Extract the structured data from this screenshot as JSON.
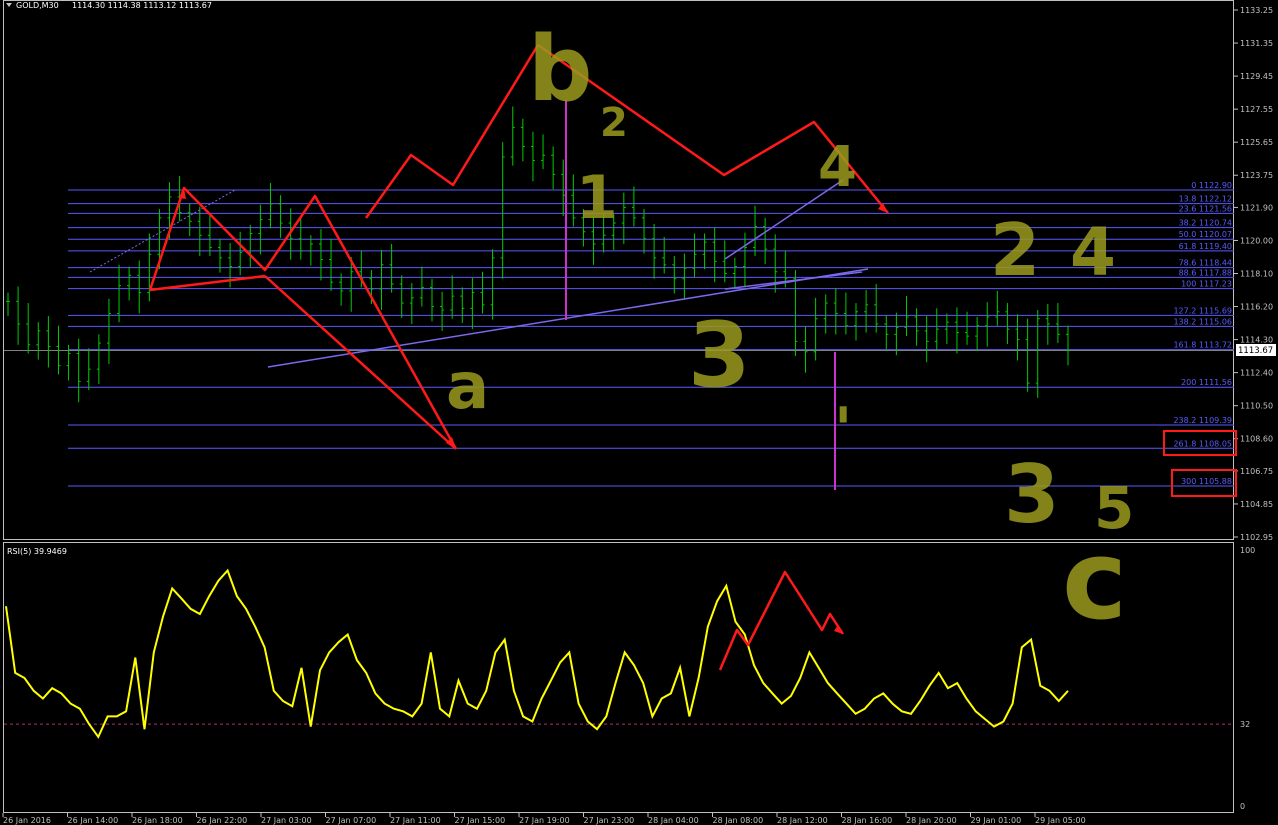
{
  "header": {
    "symbol": "GOLD,M30",
    "ohlc": "1114.30 1114.38 1113.12 1113.67"
  },
  "price_axis": {
    "ticks": [
      "1133.25",
      "1131.35",
      "1129.45",
      "1127.55",
      "1125.65",
      "1123.75",
      "1121.90",
      "1120.00",
      "1118.10",
      "1116.20",
      "1114.30",
      "1112.40",
      "1110.50",
      "1108.60",
      "1106.75",
      "1104.85",
      "1102.95"
    ],
    "current_price": "1113.67"
  },
  "rsi": {
    "label": "RSI(5) 39.9469",
    "axis_ticks": [
      "100",
      "32",
      "0"
    ],
    "level": 32
  },
  "time_axis": {
    "ticks": [
      "26 Jan 2016",
      "26 Jan 14:00",
      "26 Jan 18:00",
      "26 Jan 22:00",
      "27 Jan 03:00",
      "27 Jan 07:00",
      "27 Jan 11:00",
      "27 Jan 15:00",
      "27 Jan 19:00",
      "27 Jan 23:00",
      "28 Jan 04:00",
      "28 Jan 08:00",
      "28 Jan 12:00",
      "28 Jan 16:00",
      "28 Jan 20:00",
      "29 Jan 01:00",
      "29 Jan 05:00"
    ]
  },
  "fib_levels": [
    {
      "label": "0 1122.90",
      "price": 1122.9
    },
    {
      "label": "13.8 1122.12",
      "price": 1122.12
    },
    {
      "label": "23.6 1121.56",
      "price": 1121.56
    },
    {
      "label": "38.2 1120.74",
      "price": 1120.74
    },
    {
      "label": "50.0 1120.07",
      "price": 1120.07
    },
    {
      "label": "61.8 1119.40",
      "price": 1119.4
    },
    {
      "label": "78.6 1118.44",
      "price": 1118.44
    },
    {
      "label": "88.6 1117.88",
      "price": 1117.88
    },
    {
      "label": "100 1117.23",
      "price": 1117.23
    },
    {
      "label": "127.2 1115.69",
      "price": 1115.69
    },
    {
      "label": "138.2 1115.06",
      "price": 1115.06
    },
    {
      "label": "161.8 1113.72",
      "price": 1113.72
    },
    {
      "label": "200 1111.56",
      "price": 1111.56
    },
    {
      "label": "238.2 1109.39",
      "price": 1109.39
    },
    {
      "label": "261.8 1108.05",
      "price": 1108.05
    },
    {
      "label": "300 1105.88",
      "price": 1105.88
    }
  ],
  "highlighted_levels": [
    "261.8 1108.05",
    "300 1105.88"
  ],
  "annotations": [
    "b",
    "2",
    "1",
    "4",
    "3",
    "a",
    "2",
    "4",
    "'",
    "3",
    "5",
    "c"
  ],
  "colors": {
    "background": "#000000",
    "bars": "#00cc00",
    "fib": "#5a5aff",
    "trendline": "#7b68ee",
    "arrows": "#ff1a1a",
    "handwriting": "#9a9a1e",
    "rsi": "#ffff00",
    "spike": "#cc33cc",
    "axis_text": "#c0c0c0"
  },
  "chart_data": [
    {
      "type": "ohlc",
      "title": "GOLD,M30",
      "ylim": [
        1102.95,
        1133.25
      ],
      "series": [
        {
          "name": "GOLD,M30",
          "close_approx": [
            1116.5,
            1115.2,
            1114.0,
            1114.8,
            1113.9,
            1112.8,
            1113.5,
            1111.9,
            1112.6,
            1114.1,
            1115.8,
            1117.4,
            1118.0,
            1117.0,
            1119.2,
            1121.3,
            1122.5,
            1121.6,
            1121.1,
            1120.3,
            1119.6,
            1119.0,
            1118.5,
            1119.3,
            1120.4,
            1121.2,
            1122.1,
            1121.0,
            1120.1,
            1119.4,
            1119.8,
            1118.9,
            1117.6,
            1117.1,
            1118.2,
            1117.8,
            1117.2,
            1118.6,
            1117.5,
            1116.4,
            1116.7,
            1117.3,
            1116.2,
            1116.0,
            1116.8,
            1116.1,
            1117.0,
            1116.3,
            1119.0,
            1124.8,
            1126.5,
            1125.4,
            1124.6,
            1124.9,
            1123.8,
            1122.6,
            1121.3,
            1120.5,
            1119.8,
            1120.3,
            1121.0,
            1121.9,
            1121.3,
            1120.1,
            1119.0,
            1118.6,
            1117.8,
            1118.4,
            1119.2,
            1119.9,
            1118.8,
            1118.1,
            1118.5,
            1119.6,
            1120.8,
            1119.5,
            1118.2,
            1117.8,
            1114.2,
            1113.6,
            1115.5,
            1116.4,
            1115.8,
            1115.1,
            1115.9,
            1116.3,
            1115.2,
            1114.6,
            1115.0,
            1115.6,
            1114.8,
            1114.2,
            1114.9,
            1115.3,
            1114.7,
            1114.5,
            1115.1,
            1115.6,
            1115.9,
            1114.9,
            1114.3,
            1111.8,
            1115.5,
            1115.2,
            1114.6,
            1113.67
          ]
        }
      ]
    },
    {
      "type": "line",
      "title": "RSI(5) 39.9469",
      "ylim": [
        0,
        100
      ],
      "series": [
        {
          "name": "RSI(5)",
          "values": [
            78,
            52,
            50,
            45,
            42,
            46,
            44,
            40,
            38,
            32,
            27,
            35,
            35,
            37,
            58,
            30,
            60,
            74,
            85,
            81,
            77,
            75,
            82,
            88,
            92,
            82,
            77,
            70,
            62,
            45,
            41,
            39,
            54,
            31,
            53,
            60,
            64,
            67,
            57,
            52,
            44,
            40,
            38,
            37,
            35,
            40,
            60,
            38,
            35,
            49,
            40,
            38,
            45,
            60,
            65,
            45,
            35,
            33,
            42,
            49,
            56,
            60,
            40,
            33,
            30,
            35,
            48,
            60,
            55,
            48,
            35,
            42,
            44,
            54,
            35,
            50,
            70,
            80,
            86,
            72,
            67,
            55,
            48,
            44,
            40,
            43,
            50,
            60,
            54,
            48,
            44,
            40,
            36,
            38,
            42,
            44,
            40,
            37,
            36,
            41,
            47,
            52,
            46,
            48,
            42,
            37,
            34,
            31,
            33,
            40,
            62,
            65,
            47,
            45,
            41,
            45
          ]
        }
      ]
    }
  ]
}
